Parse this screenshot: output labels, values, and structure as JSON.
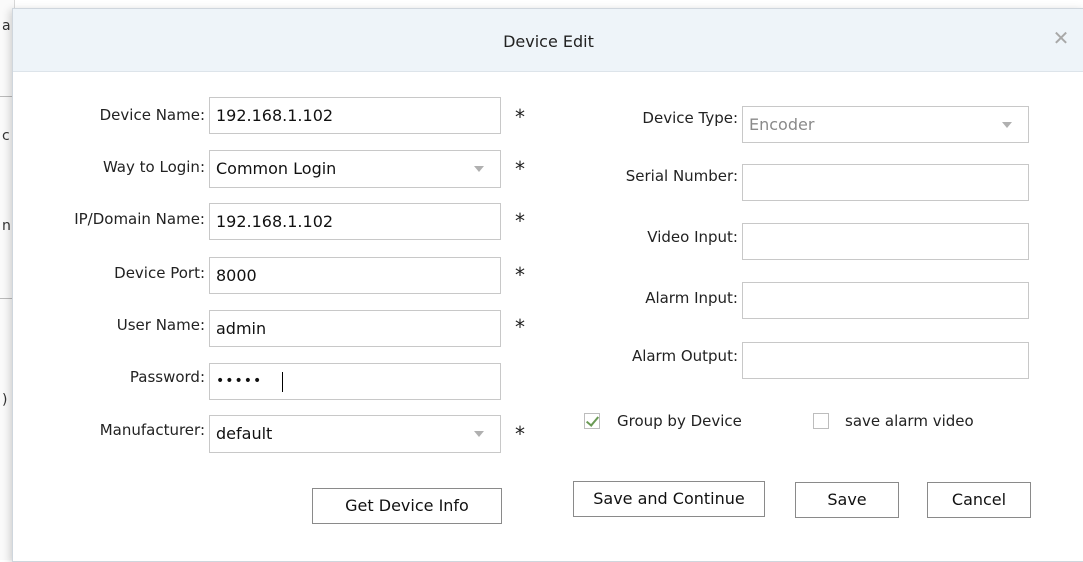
{
  "dialog": {
    "title": "Device Edit"
  },
  "form_left": {
    "device_name": {
      "label": "Device Name:",
      "value": "192.168.1.102",
      "required": "*"
    },
    "way_to_login": {
      "label": "Way to Login:",
      "value": "Common Login",
      "required": "*"
    },
    "ip_domain": {
      "label": "IP/Domain Name:",
      "value": "192.168.1.102",
      "required": "*"
    },
    "device_port": {
      "label": "Device Port:",
      "value": "8000",
      "required": "*"
    },
    "user_name": {
      "label": "User Name:",
      "value": "admin",
      "required": "*"
    },
    "password": {
      "label": "Password:",
      "value": "•••••"
    },
    "manufacturer": {
      "label": "Manufacturer:",
      "value": "default",
      "required": "*"
    }
  },
  "form_right": {
    "device_type": {
      "label": "Device Type:",
      "value": "Encoder"
    },
    "serial_number": {
      "label": "Serial Number:",
      "value": ""
    },
    "video_input": {
      "label": "Video Input:",
      "value": ""
    },
    "alarm_input": {
      "label": "Alarm Input:",
      "value": ""
    },
    "alarm_output": {
      "label": "Alarm Output:",
      "value": ""
    },
    "group_by_device": {
      "label": "Group by Device",
      "checked": true
    },
    "save_alarm_video": {
      "label": "save alarm video",
      "checked": false
    }
  },
  "buttons": {
    "get_device_info": "Get Device Info",
    "save_and_continue": "Save and Continue",
    "save": "Save",
    "cancel": "Cancel"
  },
  "background_fragments": [
    "a",
    "c",
    "n",
    ")"
  ],
  "icons": {
    "close": "close-icon",
    "dropdown": "chevron-down-icon",
    "check": "check-icon"
  },
  "colors": {
    "titlebar_bg": "#eef4f9",
    "check_color": "#6a9a55"
  }
}
